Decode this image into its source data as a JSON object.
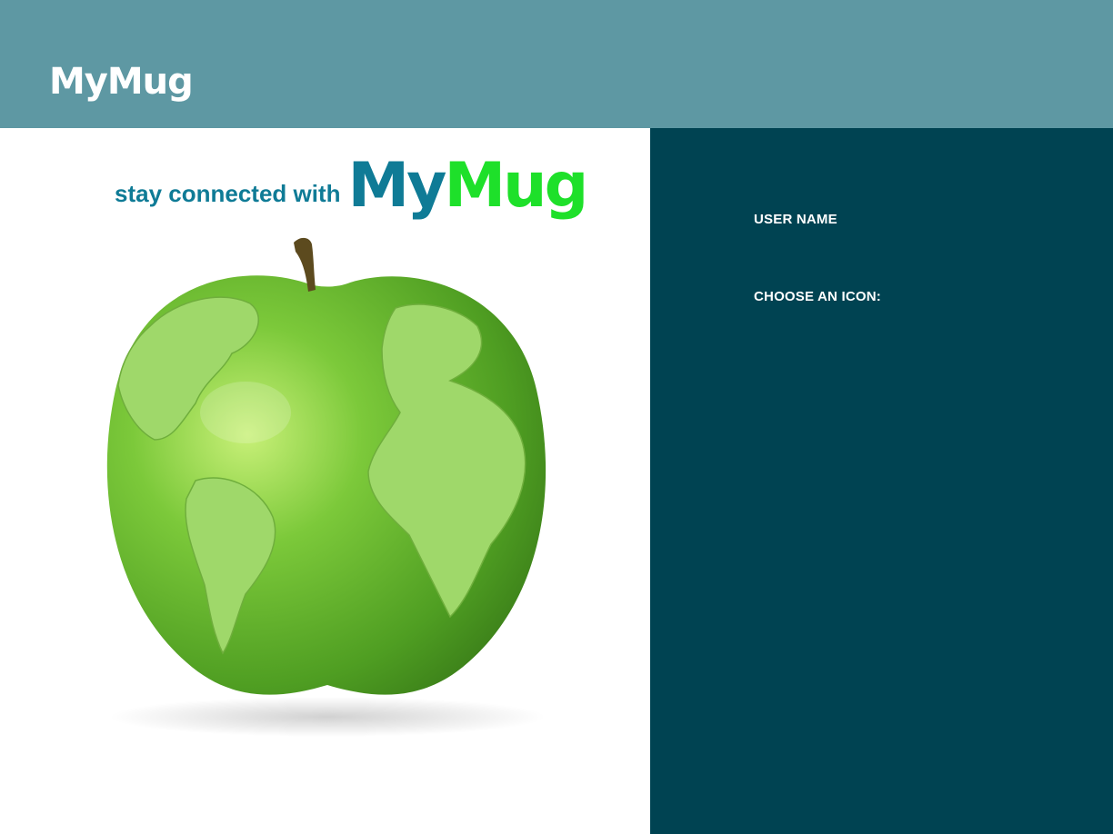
{
  "header": {
    "logo_text": "MyMug"
  },
  "hero": {
    "tagline": "stay connected with",
    "brand_part1": "My",
    "brand_part2": "Mug"
  },
  "form": {
    "username_label": "USER NAME",
    "icon_label": "CHOOSE AN ICON:"
  },
  "colors": {
    "header_bg": "#5e98a3",
    "form_bg": "#004352",
    "brand_blue": "#0f7b96",
    "brand_green": "#1ee02a",
    "apple_green": "#5cb82c"
  },
  "images": {
    "hero_image": "green-apple-globe-icon"
  }
}
